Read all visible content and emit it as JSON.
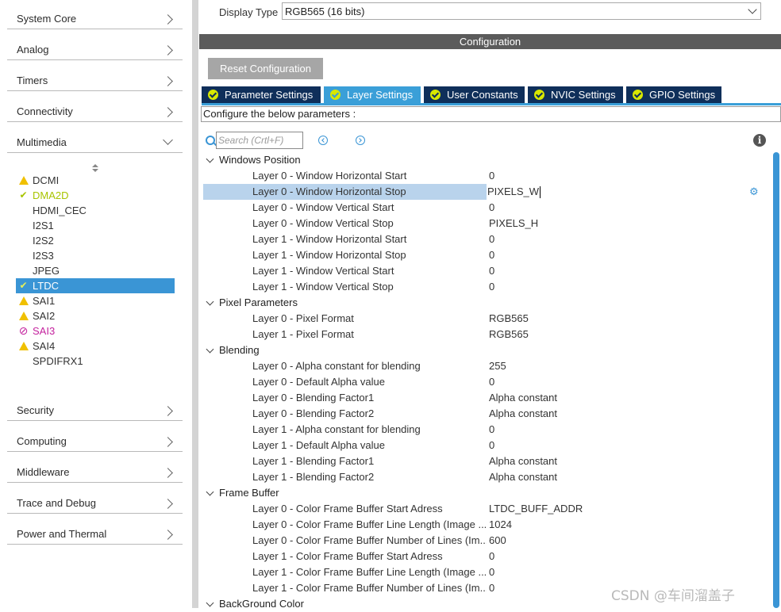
{
  "sidebar": {
    "categories_top": [
      {
        "label": "System Core"
      },
      {
        "label": "Analog"
      },
      {
        "label": "Timers"
      },
      {
        "label": "Connectivity"
      },
      {
        "label": "Multimedia"
      }
    ],
    "multimedia_items": [
      {
        "label": "DCMI",
        "status": "warning"
      },
      {
        "label": "DMA2D",
        "status": "ok"
      },
      {
        "label": "HDMI_CEC",
        "status": "none"
      },
      {
        "label": "I2S1",
        "status": "none"
      },
      {
        "label": "I2S2",
        "status": "none"
      },
      {
        "label": "I2S3",
        "status": "none"
      },
      {
        "label": "JPEG",
        "status": "none"
      },
      {
        "label": "LTDC",
        "status": "ok",
        "selected": true
      },
      {
        "label": "SAI1",
        "status": "warning"
      },
      {
        "label": "SAI2",
        "status": "warning"
      },
      {
        "label": "SAI3",
        "status": "error"
      },
      {
        "label": "SAI4",
        "status": "warning"
      },
      {
        "label": "SPDIFRX1",
        "status": "none"
      }
    ],
    "categories_bottom": [
      {
        "label": "Security"
      },
      {
        "label": "Computing"
      },
      {
        "label": "Middleware"
      },
      {
        "label": "Trace and Debug"
      },
      {
        "label": "Power and Thermal"
      }
    ]
  },
  "display": {
    "label": "Display Type",
    "value": "RGB565 (16 bits)"
  },
  "config": {
    "title": "Configuration",
    "reset_label": "Reset Configuration",
    "tabs": [
      {
        "label": "Parameter Settings"
      },
      {
        "label": "Layer Settings",
        "active": true
      },
      {
        "label": "User Constants"
      },
      {
        "label": "NVIC Settings"
      },
      {
        "label": "GPIO Settings"
      }
    ],
    "configure_text": "Configure the below parameters :",
    "search_placeholder": "Search (Crtl+F)"
  },
  "tree": [
    {
      "type": "group",
      "label": "Windows Position"
    },
    {
      "type": "param",
      "name": "Layer 0 - Window Horizontal Start",
      "value": "0"
    },
    {
      "type": "param",
      "name": "Layer 0 - Window Horizontal Stop",
      "value": "PIXELS_W",
      "highlight": true
    },
    {
      "type": "param",
      "name": "Layer 0 - Window Vertical Start",
      "value": "0"
    },
    {
      "type": "param",
      "name": "Layer 0 - Window Vertical Stop",
      "value": "PIXELS_H"
    },
    {
      "type": "param",
      "name": "Layer 1 - Window Horizontal Start",
      "value": "0"
    },
    {
      "type": "param",
      "name": "Layer 1 - Window Horizontal Stop",
      "value": "0"
    },
    {
      "type": "param",
      "name": "Layer 1 - Window Vertical Start",
      "value": "0"
    },
    {
      "type": "param",
      "name": "Layer 1 - Window Vertical Stop",
      "value": "0"
    },
    {
      "type": "group",
      "label": "Pixel Parameters"
    },
    {
      "type": "param",
      "name": "Layer 0 - Pixel Format",
      "value": "RGB565"
    },
    {
      "type": "param",
      "name": "Layer 1 - Pixel Format",
      "value": "RGB565"
    },
    {
      "type": "group",
      "label": "Blending"
    },
    {
      "type": "param",
      "name": "Layer 0 - Alpha constant for blending",
      "value": "255"
    },
    {
      "type": "param",
      "name": "Layer 0 - Default Alpha value",
      "value": "0"
    },
    {
      "type": "param",
      "name": "Layer 0 - Blending Factor1",
      "value": "Alpha constant"
    },
    {
      "type": "param",
      "name": "Layer 0 - Blending Factor2",
      "value": "Alpha constant"
    },
    {
      "type": "param",
      "name": "Layer 1 - Alpha constant for blending",
      "value": "0"
    },
    {
      "type": "param",
      "name": "Layer 1 - Default Alpha value",
      "value": "0"
    },
    {
      "type": "param",
      "name": "Layer 1 - Blending Factor1",
      "value": "Alpha constant"
    },
    {
      "type": "param",
      "name": "Layer 1 - Blending Factor2",
      "value": "Alpha constant"
    },
    {
      "type": "group",
      "label": "Frame Buffer"
    },
    {
      "type": "param",
      "name": "Layer 0 - Color Frame Buffer Start Adress",
      "value": "LTDC_BUFF_ADDR"
    },
    {
      "type": "param",
      "name": "Layer 0 - Color Frame Buffer Line Length (Image ...",
      "value": "1024"
    },
    {
      "type": "param",
      "name": "Layer 0 - Color Frame Buffer Number of Lines (Im...",
      "value": "600"
    },
    {
      "type": "param",
      "name": "Layer 1 - Color Frame Buffer Start Adress",
      "value": "0"
    },
    {
      "type": "param",
      "name": "Layer 1 - Color Frame Buffer Line Length (Image ...",
      "value": "0"
    },
    {
      "type": "param",
      "name": "Layer 1 - Color Frame Buffer Number of Lines (Im...",
      "value": "0"
    },
    {
      "type": "group",
      "label": "BackGround Color"
    }
  ],
  "watermark": "CSDN @车间溜盖子",
  "colors": {
    "accent": "#3a95d5",
    "tab_dark": "#0f2f5a",
    "ok": "#a8c400",
    "warn": "#f0c000",
    "error": "#c4229e"
  }
}
